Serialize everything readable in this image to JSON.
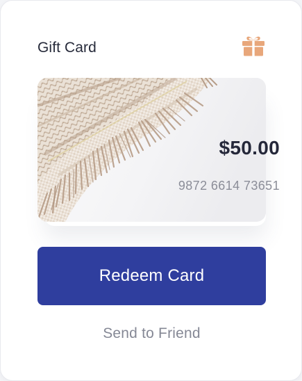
{
  "header": {
    "title": "Gift Card",
    "icon": "gift-icon",
    "icon_color": "#E8A77B"
  },
  "card": {
    "amount": "$50.00",
    "number": "9872 6614 73651",
    "image": "knitted-pillow-with-fringe"
  },
  "actions": {
    "redeem_label": "Redeem Card",
    "send_label": "Send to Friend"
  },
  "colors": {
    "primary": "#2F3E9E",
    "text_dark": "#262A3A",
    "text_muted": "#858895",
    "background": "#FFFFFF"
  }
}
